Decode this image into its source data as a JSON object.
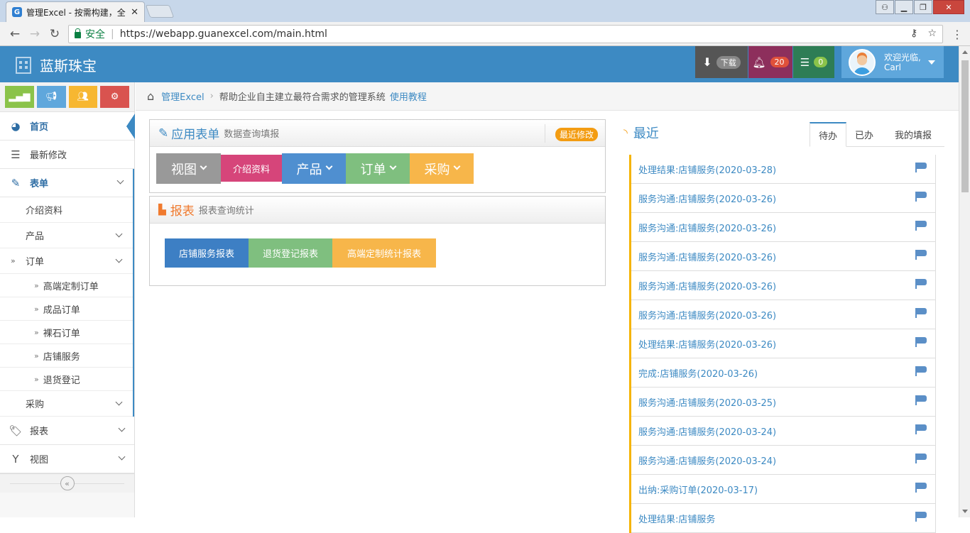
{
  "browser": {
    "tab_title": "管理Excel - 按需构建，全",
    "tab_favicon": "G",
    "tab_close": "✕",
    "security_label": "安全",
    "url": "https://webapp.guanexcel.com/main.html"
  },
  "header": {
    "brand": "蓝斯珠宝",
    "download_label": "下载",
    "notifications_count": "20",
    "tasks_count": "0",
    "welcome": "欢迎光临,",
    "user_name": "Carl"
  },
  "sidebar": {
    "shortcut_colors": [
      "#8bc34a",
      "#5fa7dc",
      "#f7b731",
      "#d9534f"
    ],
    "items": [
      {
        "label": "首页",
        "icon": "dashboard-icon"
      },
      {
        "label": "最新修改",
        "icon": "list-icon"
      },
      {
        "label": "表单",
        "icon": "edit-icon"
      },
      {
        "label": "报表",
        "icon": "tag-icon"
      },
      {
        "label": "视图",
        "icon": "filter-icon"
      }
    ],
    "form_children": [
      {
        "label": "介绍资料"
      },
      {
        "label": "产品"
      },
      {
        "label": "订单"
      },
      {
        "label": "采购"
      }
    ],
    "order_children": [
      {
        "label": "高端定制订单"
      },
      {
        "label": "成品订单"
      },
      {
        "label": "裸石订单"
      },
      {
        "label": "店铺服务"
      },
      {
        "label": "退货登记"
      }
    ]
  },
  "breadcrumb": {
    "link": "管理Excel",
    "description": "帮助企业自主建立最符合需求的管理系统",
    "tutorial": "使用教程"
  },
  "app_forms": {
    "title": "应用表单",
    "subtitle": "数据查询填报",
    "badge": "最近修改",
    "buttons": [
      {
        "label": "视图",
        "color": "#999999",
        "dropdown": true
      },
      {
        "label": "介绍资料",
        "color": "#d6457a",
        "dropdown": false
      },
      {
        "label": "产品",
        "color": "#4f8fd0",
        "dropdown": true
      },
      {
        "label": "订单",
        "color": "#7fbf7f",
        "dropdown": true
      },
      {
        "label": "采购",
        "color": "#f7b64a",
        "dropdown": true
      }
    ]
  },
  "reports": {
    "title": "报表",
    "subtitle": "报表查询统计",
    "buttons": [
      {
        "label": "店铺服务报表",
        "color": "#3d7fc4"
      },
      {
        "label": "退货登记报表",
        "color": "#7fbf7f"
      },
      {
        "label": "高端定制统计报表",
        "color": "#f7b64a"
      }
    ]
  },
  "recent": {
    "title": "最近",
    "tabs": [
      "待办",
      "已办",
      "我的填报"
    ],
    "items": [
      "处理结果:店铺服务(2020-03-28)",
      "服务沟通:店铺服务(2020-03-26)",
      "服务沟通:店铺服务(2020-03-26)",
      "服务沟通:店铺服务(2020-03-26)",
      "服务沟通:店铺服务(2020-03-26)",
      "服务沟通:店铺服务(2020-03-26)",
      "处理结果:店铺服务(2020-03-26)",
      "完成:店铺服务(2020-03-26)",
      "服务沟通:店铺服务(2020-03-25)",
      "服务沟通:店铺服务(2020-03-24)",
      "服务沟通:店铺服务(2020-03-24)",
      "出纳:采购订单(2020-03-17)",
      "处理结果:店铺服务"
    ]
  }
}
